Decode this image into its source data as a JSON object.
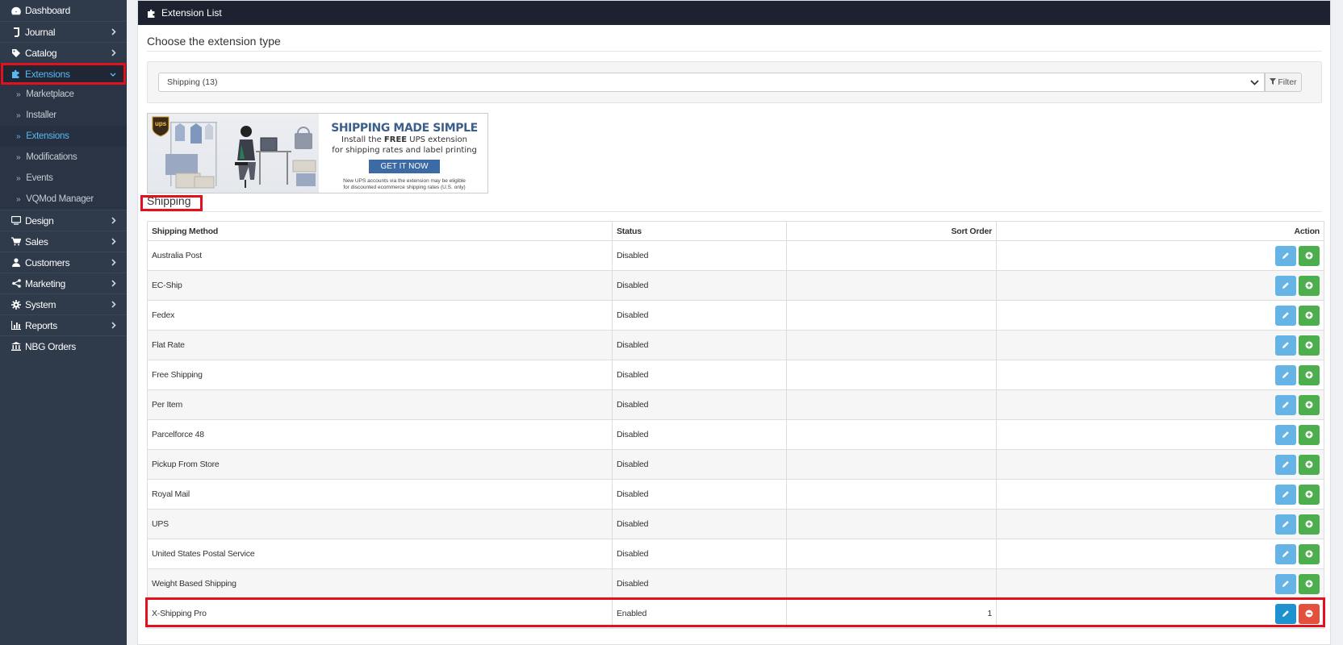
{
  "sidebar": {
    "items": [
      {
        "label": "Dashboard",
        "icon": "dashboard-icon",
        "has_children": false
      },
      {
        "label": "Journal",
        "icon": "journal-icon",
        "has_children": true
      },
      {
        "label": "Catalog",
        "icon": "tags-icon",
        "has_children": true
      },
      {
        "label": "Extensions",
        "icon": "puzzle-icon",
        "has_children": true,
        "expanded": true
      },
      {
        "label": "Design",
        "icon": "monitor-icon",
        "has_children": true
      },
      {
        "label": "Sales",
        "icon": "cart-icon",
        "has_children": true
      },
      {
        "label": "Customers",
        "icon": "user-icon",
        "has_children": true
      },
      {
        "label": "Marketing",
        "icon": "share-icon",
        "has_children": true
      },
      {
        "label": "System",
        "icon": "cog-icon",
        "has_children": true
      },
      {
        "label": "Reports",
        "icon": "bar-chart-icon",
        "has_children": true
      },
      {
        "label": "NBG Orders",
        "icon": "bank-icon",
        "has_children": false
      }
    ],
    "extensions_sub": [
      {
        "label": "Marketplace"
      },
      {
        "label": "Installer"
      },
      {
        "label": "Extensions",
        "active": true
      },
      {
        "label": "Modifications"
      },
      {
        "label": "Events"
      },
      {
        "label": "VQMod Manager"
      }
    ]
  },
  "panel": {
    "heading": "Extension List",
    "choose_title": "Choose the extension type",
    "select_value": "Shipping (13)",
    "filter_label": "Filter",
    "section_heading": "Shipping"
  },
  "banner": {
    "logo_text": "ups",
    "title": "SHIPPING MADE SIMPLE",
    "line1_pre": "Install the ",
    "line1_bold": "FREE",
    "line1_post": " UPS extension",
    "line2": "for shipping rates and label printing",
    "button": "GET IT NOW",
    "note1": "New UPS accounts via the extension may be eligible",
    "note2": "for discounted ecommerce shipping rates (U.S. only)"
  },
  "table": {
    "headers": [
      "Shipping Method",
      "Status",
      "Sort Order",
      "Action"
    ],
    "rows": [
      {
        "name": "Australia Post",
        "status": "Disabled",
        "sort": "",
        "installed": false
      },
      {
        "name": "EC-Ship",
        "status": "Disabled",
        "sort": "",
        "installed": false
      },
      {
        "name": "Fedex",
        "status": "Disabled",
        "sort": "",
        "installed": false
      },
      {
        "name": "Flat Rate",
        "status": "Disabled",
        "sort": "",
        "installed": false
      },
      {
        "name": "Free Shipping",
        "status": "Disabled",
        "sort": "",
        "installed": false
      },
      {
        "name": "Per Item",
        "status": "Disabled",
        "sort": "",
        "installed": false
      },
      {
        "name": "Parcelforce 48",
        "status": "Disabled",
        "sort": "",
        "installed": false
      },
      {
        "name": "Pickup From Store",
        "status": "Disabled",
        "sort": "",
        "installed": false
      },
      {
        "name": "Royal Mail",
        "status": "Disabled",
        "sort": "",
        "installed": false
      },
      {
        "name": "UPS",
        "status": "Disabled",
        "sort": "",
        "installed": false
      },
      {
        "name": "United States Postal Service",
        "status": "Disabled",
        "sort": "",
        "installed": false
      },
      {
        "name": "Weight Based Shipping",
        "status": "Disabled",
        "sort": "",
        "installed": false
      },
      {
        "name": "X-Shipping Pro",
        "status": "Enabled",
        "sort": "1",
        "installed": true
      }
    ]
  },
  "colors": {
    "sidebar_bg": "#2f3a4b",
    "active_link": "#5ab8f0",
    "panel_header": "#1c2230",
    "edit_button": "#66b3e6",
    "edit_button_enabled": "#1e91cf",
    "install_button": "#4cae4c",
    "uninstall_button": "#e3503e",
    "highlight": "#e3101d"
  }
}
